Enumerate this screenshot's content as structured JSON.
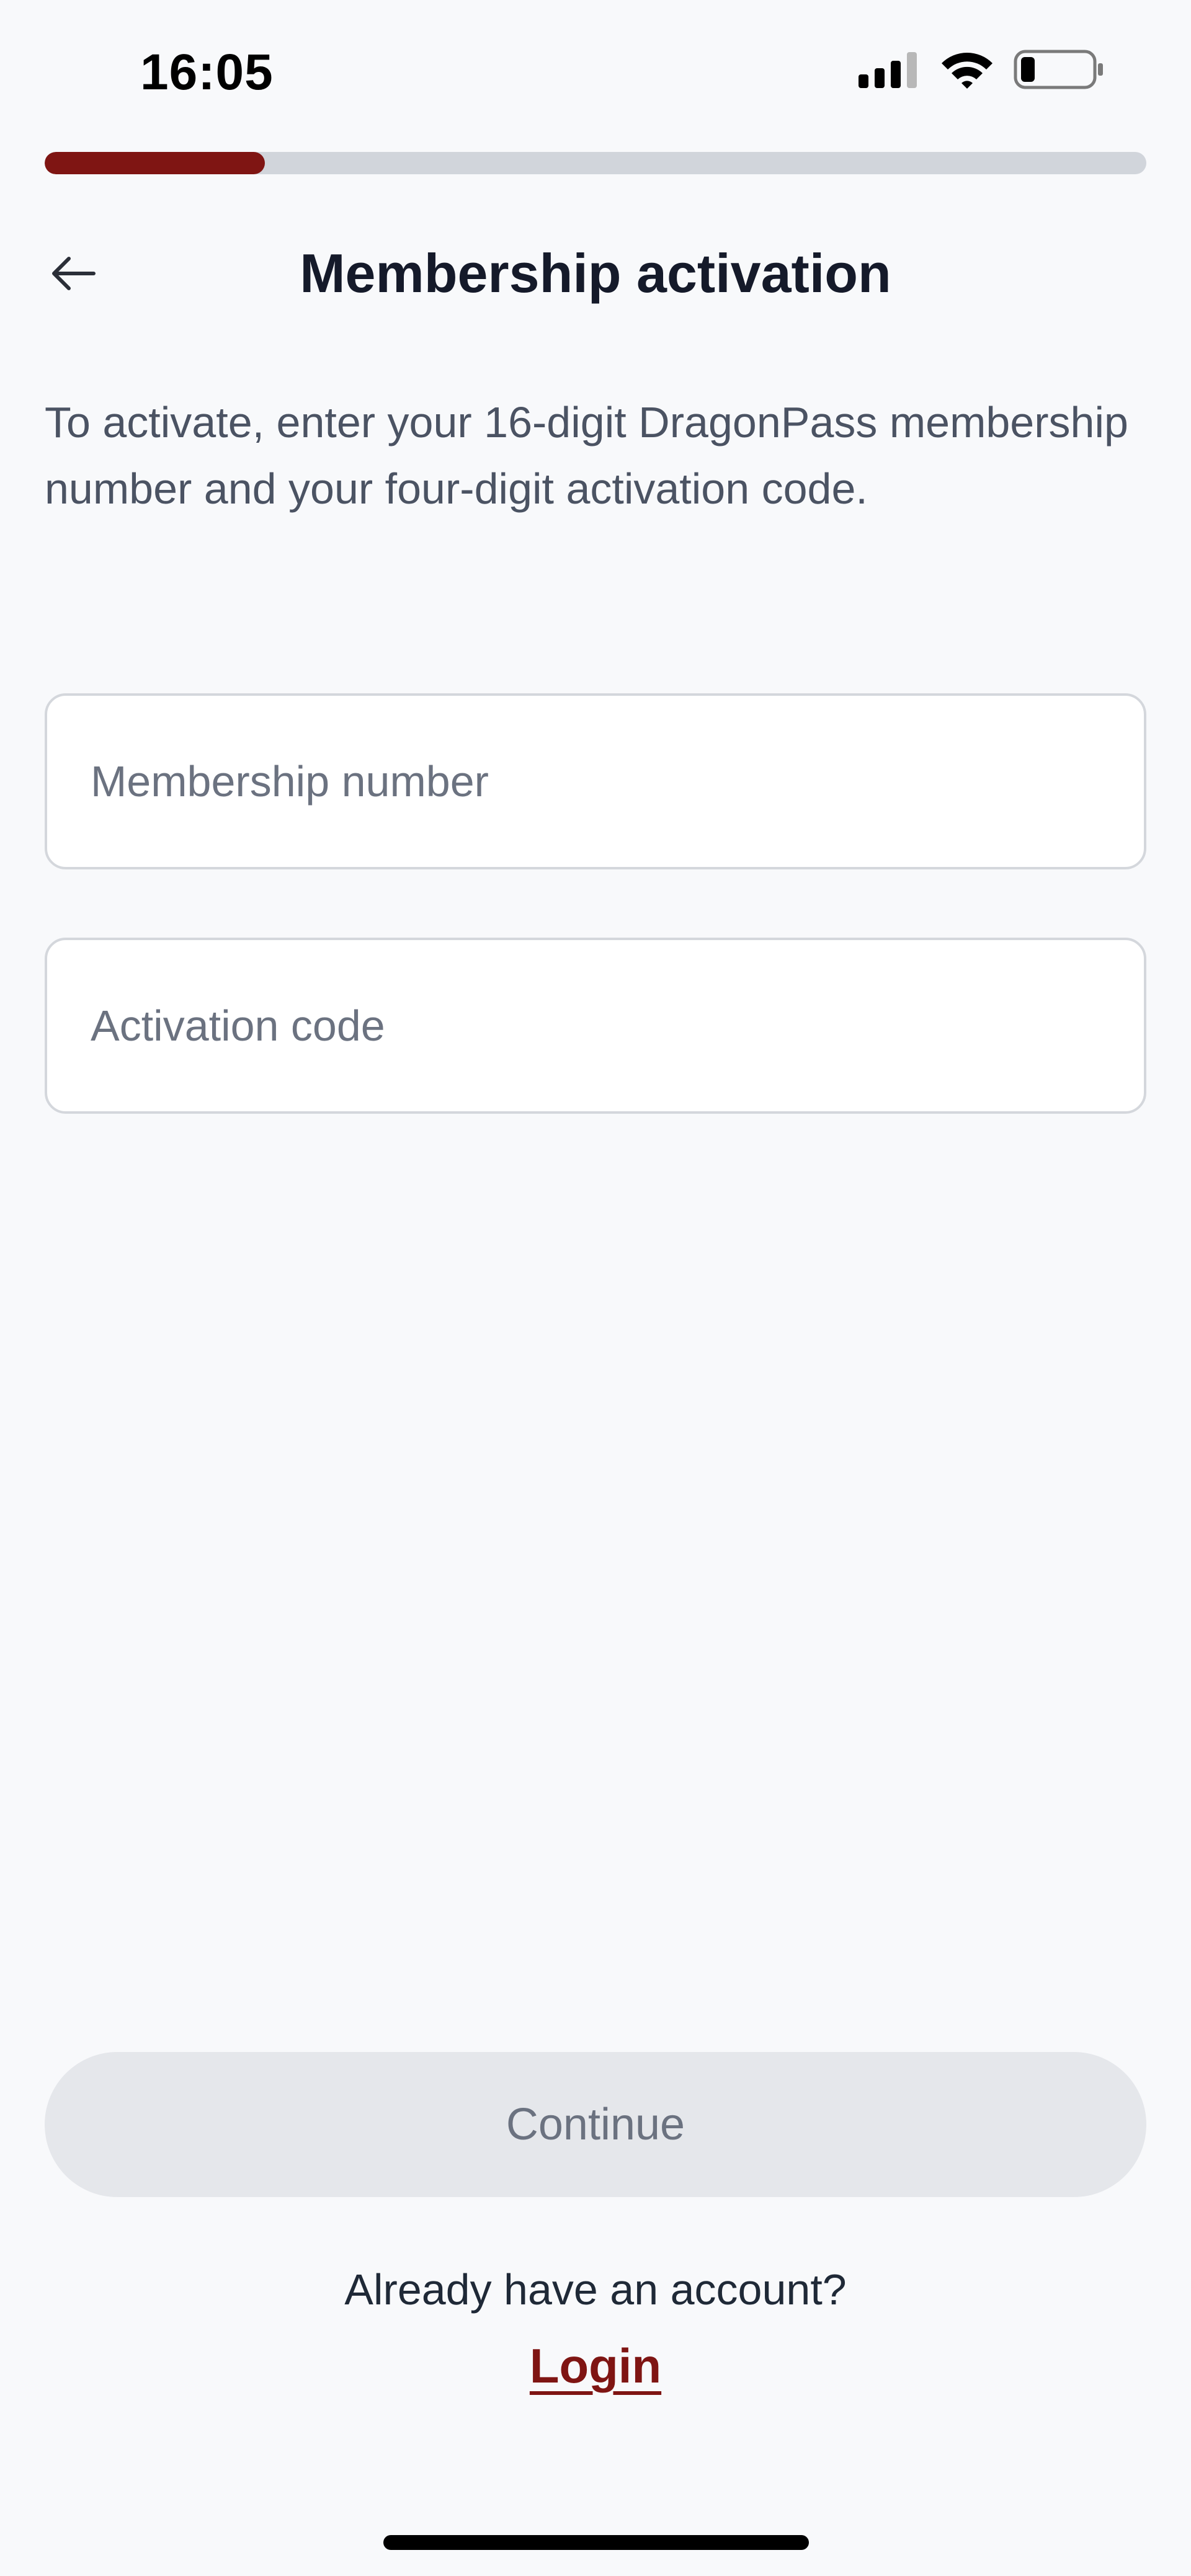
{
  "status_bar": {
    "time": "16:05",
    "icons": [
      "cellular-signal-icon",
      "wifi-icon",
      "battery-icon"
    ],
    "battery_level": 0.2
  },
  "progress": {
    "value": 0.2,
    "fill_color": "#7f1513",
    "track_color": "#d1d5db"
  },
  "header": {
    "back_icon": "arrow-left-icon",
    "title": "Membership activation"
  },
  "description": "To activate, enter your 16-digit DragonPass membership number and your four-digit activation code.",
  "form": {
    "membership_number": {
      "placeholder": "Membership number",
      "value": ""
    },
    "activation_code": {
      "placeholder": "Activation code",
      "value": ""
    }
  },
  "continue_button": {
    "label": "Continue",
    "state": "disabled"
  },
  "footer": {
    "prompt": "Already have an account?",
    "login_label": "Login"
  },
  "colors": {
    "accent": "#7f1513",
    "background": "#f8f9fb",
    "title": "#151a2a",
    "muted_text": "#6b7280"
  }
}
